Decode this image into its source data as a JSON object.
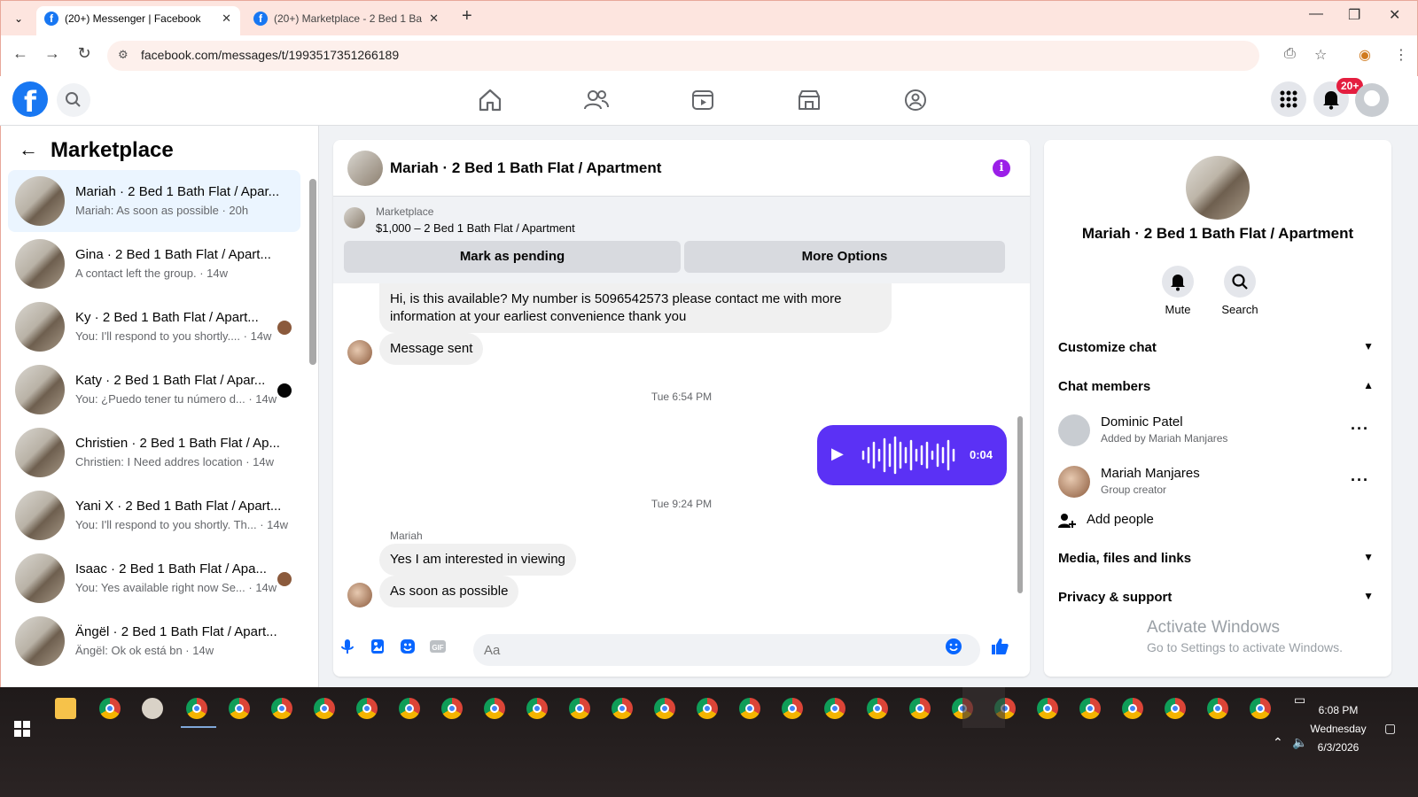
{
  "browser": {
    "tabs": [
      {
        "title": "(20+) Messenger | Facebook",
        "active": true
      },
      {
        "title": "(20+) Marketplace - 2 Bed 1 Ba",
        "active": false
      }
    ],
    "url": "facebook.com/messages/t/1993517351266189"
  },
  "fb": {
    "notifications_badge": "20+"
  },
  "sidebar": {
    "title": "Marketplace",
    "conversations": [
      {
        "name": "Mariah · 2 Bed 1 Bath Flat / Apar...",
        "snippet": "Mariah: As soon as possible · 20h",
        "active": true
      },
      {
        "name": "Gina · 2 Bed 1 Bath Flat / Apart...",
        "snippet": "A contact left the group. · 14w"
      },
      {
        "name": "Ky · 2 Bed 1 Bath Flat / Apart...",
        "snippet": "You: I'll respond to you shortly.... · 14w"
      },
      {
        "name": "Katy · 2 Bed 1 Bath Flat / Apar...",
        "snippet": "You: ¿Puedo tener tu número d... · 14w"
      },
      {
        "name": "Christien · 2 Bed 1 Bath Flat / Ap...",
        "snippet": "Christien: I Need addres location · 14w"
      },
      {
        "name": "Yani X · 2 Bed 1 Bath Flat / Apart...",
        "snippet": "You: I'll respond to you shortly. Th... · 14w"
      },
      {
        "name": "Isaac · 2 Bed 1 Bath Flat / Apa...",
        "snippet": "You: Yes available right now Se... · 14w"
      },
      {
        "name": "Ängël · 2 Bed 1 Bath Flat / Apart...",
        "snippet": "Ängël: Ok ok está bn · 14w"
      }
    ]
  },
  "chat": {
    "title": "Mariah · 2 Bed 1 Bath Flat / Apartment",
    "banner": {
      "label": "Marketplace",
      "price_line": "$1,000 – 2 Bed 1 Bath Flat / Apartment",
      "mark_pending": "Mark as pending",
      "more_options": "More Options"
    },
    "messages": {
      "m1_line1": "Hi, is this available? My number is 5096542573 please contact me with more",
      "m1_line2": "information at your earliest convenience thank you",
      "m2": "Message sent",
      "time1": "Tue 6:54 PM",
      "voice_duration": "0:04",
      "time2": "Tue 9:24 PM",
      "sender": "Mariah",
      "m3": "Yes I am interested in viewing",
      "m4": "As soon as possible"
    },
    "composer_placeholder": "Aa"
  },
  "info": {
    "name": "Mariah · 2 Bed 1 Bath Flat / Apartment",
    "mute": "Mute",
    "search": "Search",
    "customize": "Customize chat",
    "members_title": "Chat members",
    "members": [
      {
        "name": "Dominic Patel",
        "sub": "Added by Mariah Manjares"
      },
      {
        "name": "Mariah Manjares",
        "sub": "Group creator"
      }
    ],
    "add_people": "Add people",
    "media": "Media, files and links",
    "privacy": "Privacy & support"
  },
  "watermark": {
    "line1": "Activate Windows",
    "line2": "Go to Settings to activate Windows."
  },
  "taskbar": {
    "time": "6:08 PM",
    "day": "Wednesday",
    "date": "6/3/2026"
  }
}
